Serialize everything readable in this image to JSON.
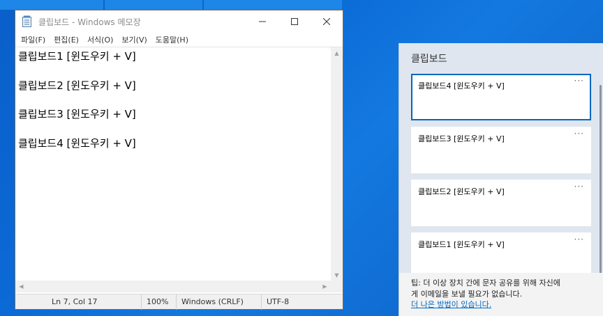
{
  "notepad": {
    "title": "클립보드 - Windows 메모장",
    "menus": [
      "파일(F)",
      "편집(E)",
      "서식(O)",
      "보기(V)",
      "도움말(H)"
    ],
    "lines": [
      "클립보드1 [윈도우키 + V]",
      "클립보드2 [윈도우키 + V]",
      "클립보드3 [윈도우키 + V]",
      "클립보드4 [윈도우키 + V]"
    ],
    "status": {
      "position": "Ln 7, Col 17",
      "zoom": "100%",
      "line_ending": "Windows (CRLF)",
      "encoding": "UTF-8"
    }
  },
  "clipboard": {
    "title": "클립보드",
    "items": [
      "클립보드4 [윈도우키 + V]",
      "클립보드3 [윈도우키 + V]",
      "클립보드2 [윈도우키 + V]",
      "클립보드1 [윈도우키 + V]"
    ],
    "more_label": "···",
    "tip_line1": "팁: 더 이상 장치 간에 문자 공유를 위해 자신에",
    "tip_line2": "게 이메일을 보낼 필요가 없습니다.",
    "tip_link": "더 나은 방법이 있습니다."
  },
  "colors": {
    "accent": "#0067c0",
    "desktop": "#0b6ad6"
  }
}
